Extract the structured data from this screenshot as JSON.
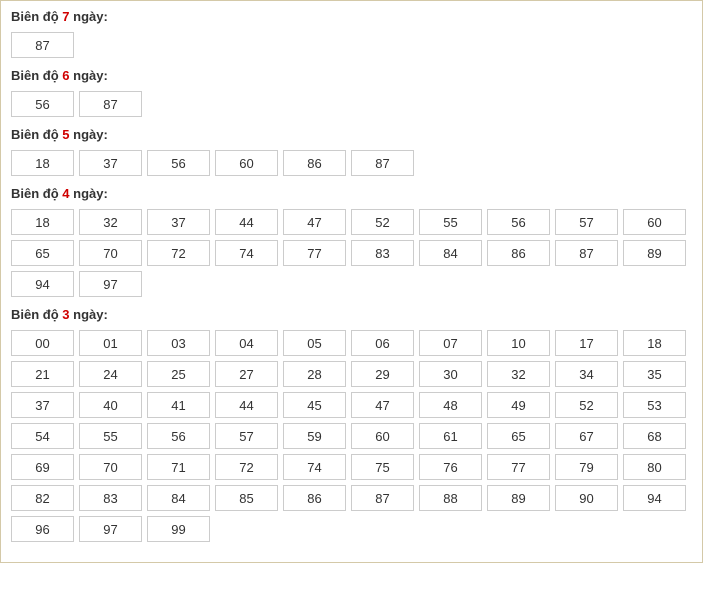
{
  "label_prefix": "Biên độ ",
  "label_suffix": " ngày:",
  "sections": [
    {
      "days": "7",
      "numbers": [
        "87"
      ]
    },
    {
      "days": "6",
      "numbers": [
        "56",
        "87"
      ]
    },
    {
      "days": "5",
      "numbers": [
        "18",
        "37",
        "56",
        "60",
        "86",
        "87"
      ]
    },
    {
      "days": "4",
      "numbers": [
        "18",
        "32",
        "37",
        "44",
        "47",
        "52",
        "55",
        "56",
        "57",
        "60",
        "65",
        "70",
        "72",
        "74",
        "77",
        "83",
        "84",
        "86",
        "87",
        "89",
        "94",
        "97"
      ]
    },
    {
      "days": "3",
      "numbers": [
        "00",
        "01",
        "03",
        "04",
        "05",
        "06",
        "07",
        "10",
        "17",
        "18",
        "21",
        "24",
        "25",
        "27",
        "28",
        "29",
        "30",
        "32",
        "34",
        "35",
        "37",
        "40",
        "41",
        "44",
        "45",
        "47",
        "48",
        "49",
        "52",
        "53",
        "54",
        "55",
        "56",
        "57",
        "59",
        "60",
        "61",
        "65",
        "67",
        "68",
        "69",
        "70",
        "71",
        "72",
        "74",
        "75",
        "76",
        "77",
        "79",
        "80",
        "82",
        "83",
        "84",
        "85",
        "86",
        "87",
        "88",
        "89",
        "90",
        "94",
        "96",
        "97",
        "99"
      ]
    }
  ]
}
